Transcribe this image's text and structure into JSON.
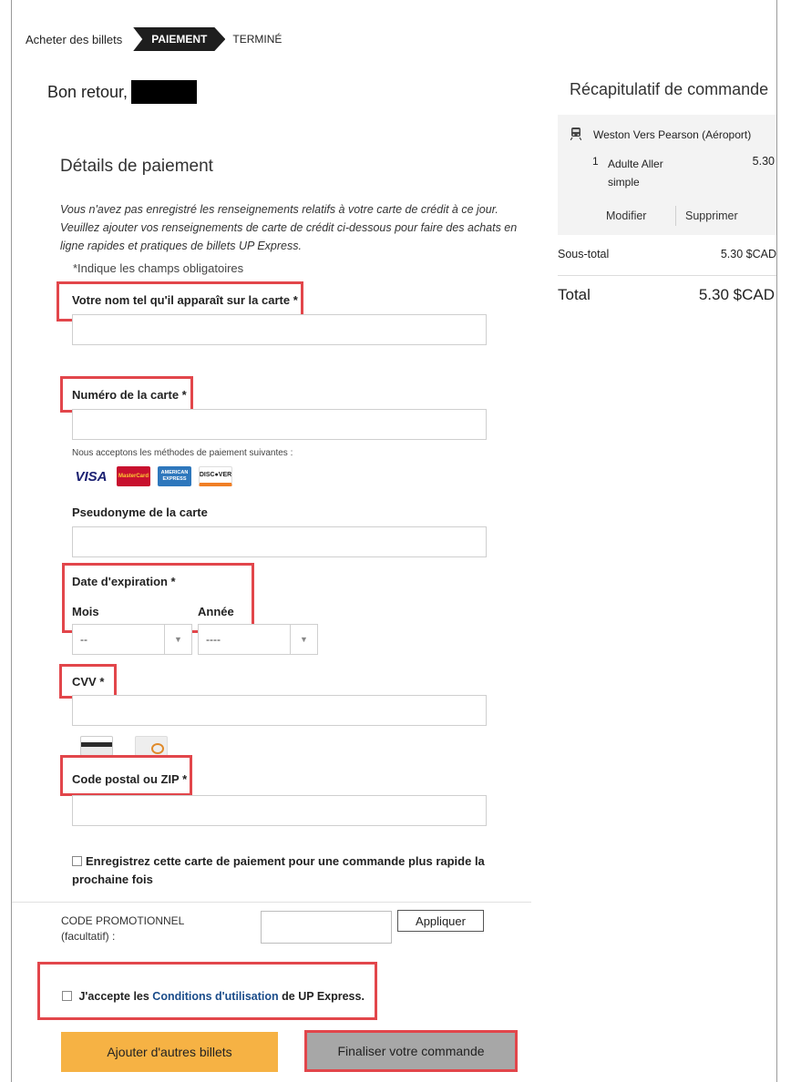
{
  "steps": {
    "buy": "Acheter des billets",
    "payment": "PAIEMENT",
    "done": "TERMINÉ"
  },
  "welcome": "Bon retour,",
  "payment": {
    "title": "Détails de paiement",
    "intro": "Vous n'avez pas enregistré les renseignements relatifs à votre carte de crédit à ce jour. Veuillez ajouter vos renseignements de carte de crédit ci-dessous pour faire des achats en ligne rapides et pratiques de billets UP Express.",
    "required_note": "*Indique les champs obligatoires",
    "name_label": "Votre nom tel qu'il apparaît sur la carte *",
    "card_number_label": "Numéro de la carte *",
    "accepted_text": "Nous acceptons les méthodes de paiement suivantes :",
    "cards": {
      "visa": "VISA",
      "mastercard": "MasterCard",
      "amex": "AMERICAN EXPRESS",
      "discover": "DISC●VER"
    },
    "nickname_label": "Pseudonyme de la carte",
    "expiry_label": "Date d'expiration *",
    "month_label": "Mois",
    "year_label": "Année",
    "month_value": "--",
    "year_value": "----",
    "cvv_label": "CVV *",
    "postal_label": "Code postal ou ZIP *",
    "save_card": "Enregistrez cette carte de paiement pour une commande plus rapide la prochaine fois",
    "promo_label_1": "CODE PROMOTIONNEL",
    "promo_label_2": "(facultatif) :",
    "apply": "Appliquer",
    "terms_pre": "J'accepte les ",
    "terms_link": "Conditions d'utilisation",
    "terms_post": " de UP Express.",
    "add_tickets": "Ajouter d'autres billets",
    "finalize": "Finaliser votre commande"
  },
  "summary": {
    "title": "Récapitulatif de commande",
    "route": "Weston Vers Pearson (Aéroport)",
    "qty": "1",
    "item": "Adulte Aller simple",
    "price": "5.30",
    "modify": "Modifier",
    "delete": "Supprimer",
    "subtotal_label": "Sous-total",
    "subtotal_value": "5.30 $CAD",
    "total_label": "Total",
    "total_value": "5.30 $CAD"
  },
  "colors": {
    "highlight": "#e2464b",
    "primary_button": "#f6b244",
    "secondary_button": "#a7a7a7",
    "link": "#1a4c8a",
    "step_active": "#1e1e1e"
  }
}
